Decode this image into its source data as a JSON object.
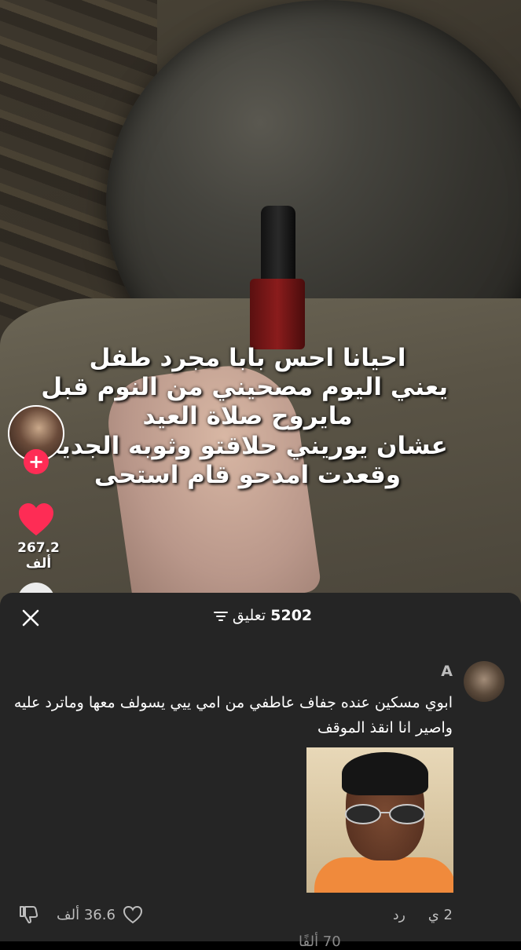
{
  "video": {
    "caption_lines": [
      "احيانا احس بابا مجرد طفل",
      "يعني اليوم مصحيني من النوم قبل",
      "مايروح صلاة العيد",
      "عشان يوريني حلاقتو وثوبه الجديد",
      "وقعدت امدحو قام استحى"
    ],
    "follow_symbol": "+",
    "like_count": "267.2 ألف",
    "icons": [
      "creator-avatar",
      "follow-plus-icon",
      "heart-icon",
      "share-icon"
    ]
  },
  "comments_sheet": {
    "close_icon": "close-icon",
    "count": "5202",
    "count_label": "تعليق",
    "sort_icon": "sort-filter-icon",
    "comments": [
      {
        "user": "A",
        "text": "ابوي مسكين عنده جفاف عاطفي من امي ييي يسولف معها وماترد عليه واصير انا انقذ الموقف",
        "time": "2 ي",
        "reply_label": "رد",
        "likes": "36.6 ألف",
        "has_image": true
      }
    ],
    "next_peek": "70 ألفًا"
  },
  "colors": {
    "sheet_bg": "#252525",
    "accent_red": "#fe2c55",
    "muted_text": "#bdbdbd"
  }
}
